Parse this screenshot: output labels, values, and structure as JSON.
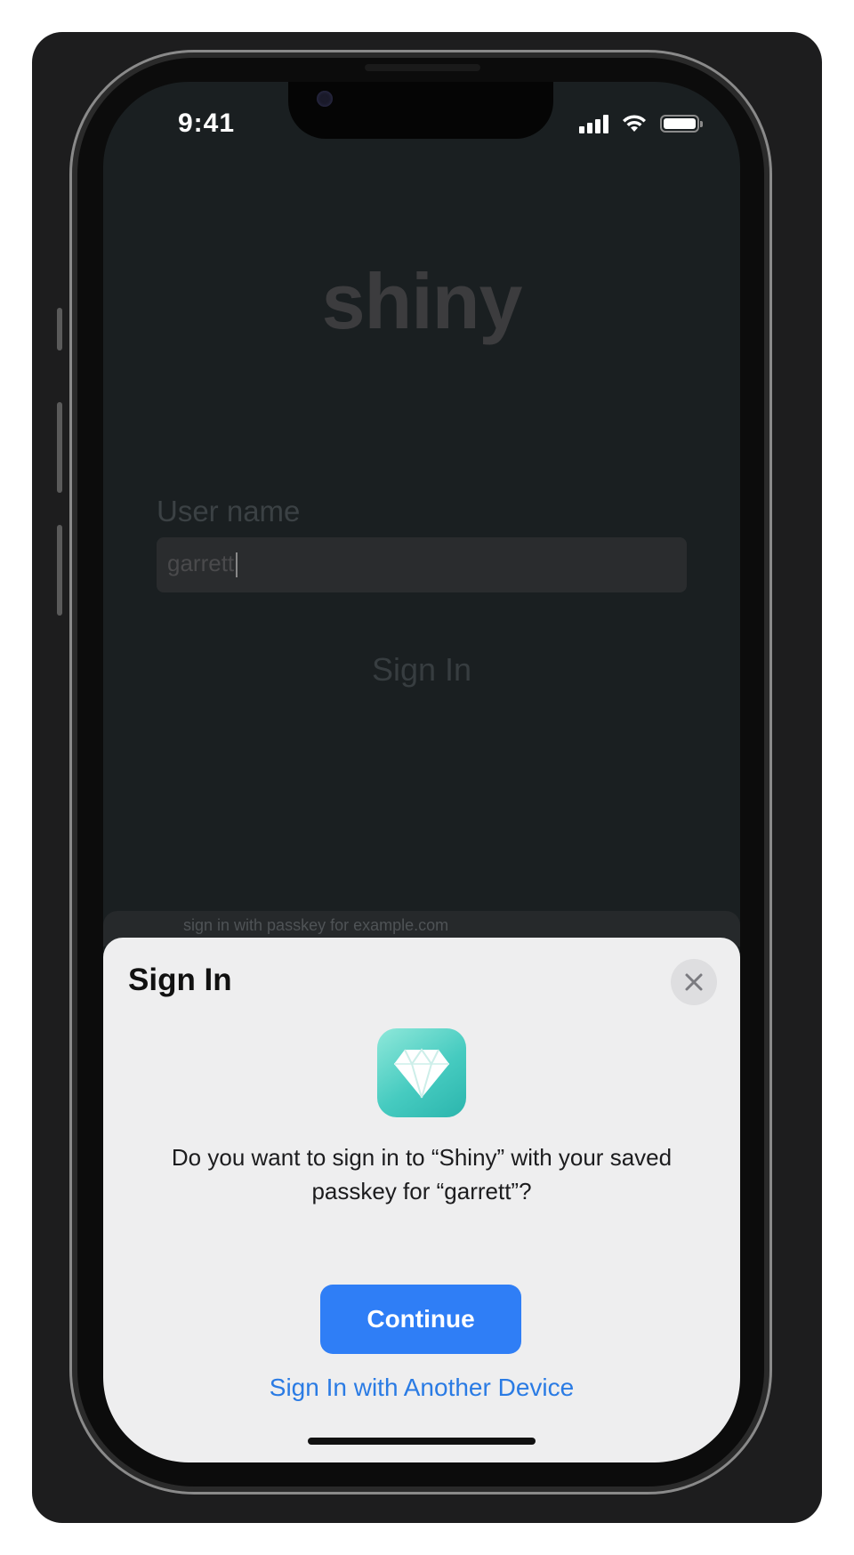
{
  "status_bar": {
    "time": "9:41",
    "icons": [
      "signal-icon",
      "wifi-icon",
      "battery-icon"
    ],
    "battery_level": 1.0
  },
  "background_app": {
    "logo": "shiny",
    "username_label": "User name",
    "username_value": "garrett",
    "sign_in_label": "Sign In",
    "partial_sheet_text": "sign in with passkey for example.com"
  },
  "sheet": {
    "title": "Sign In",
    "close_icon": "close-icon",
    "app_icon": "diamond-icon",
    "message": "Do you want to sign in to “Shiny” with your saved passkey for “garrett”?",
    "continue_label": "Continue",
    "another_device_label": "Sign In with Another Device"
  },
  "colors": {
    "accent": "#2f7ef6",
    "link": "#2a7be4",
    "sheet_bg": "#eeeeef",
    "screen_bg": "#1a1f21",
    "app_icon_teal": "#46cbc0"
  }
}
